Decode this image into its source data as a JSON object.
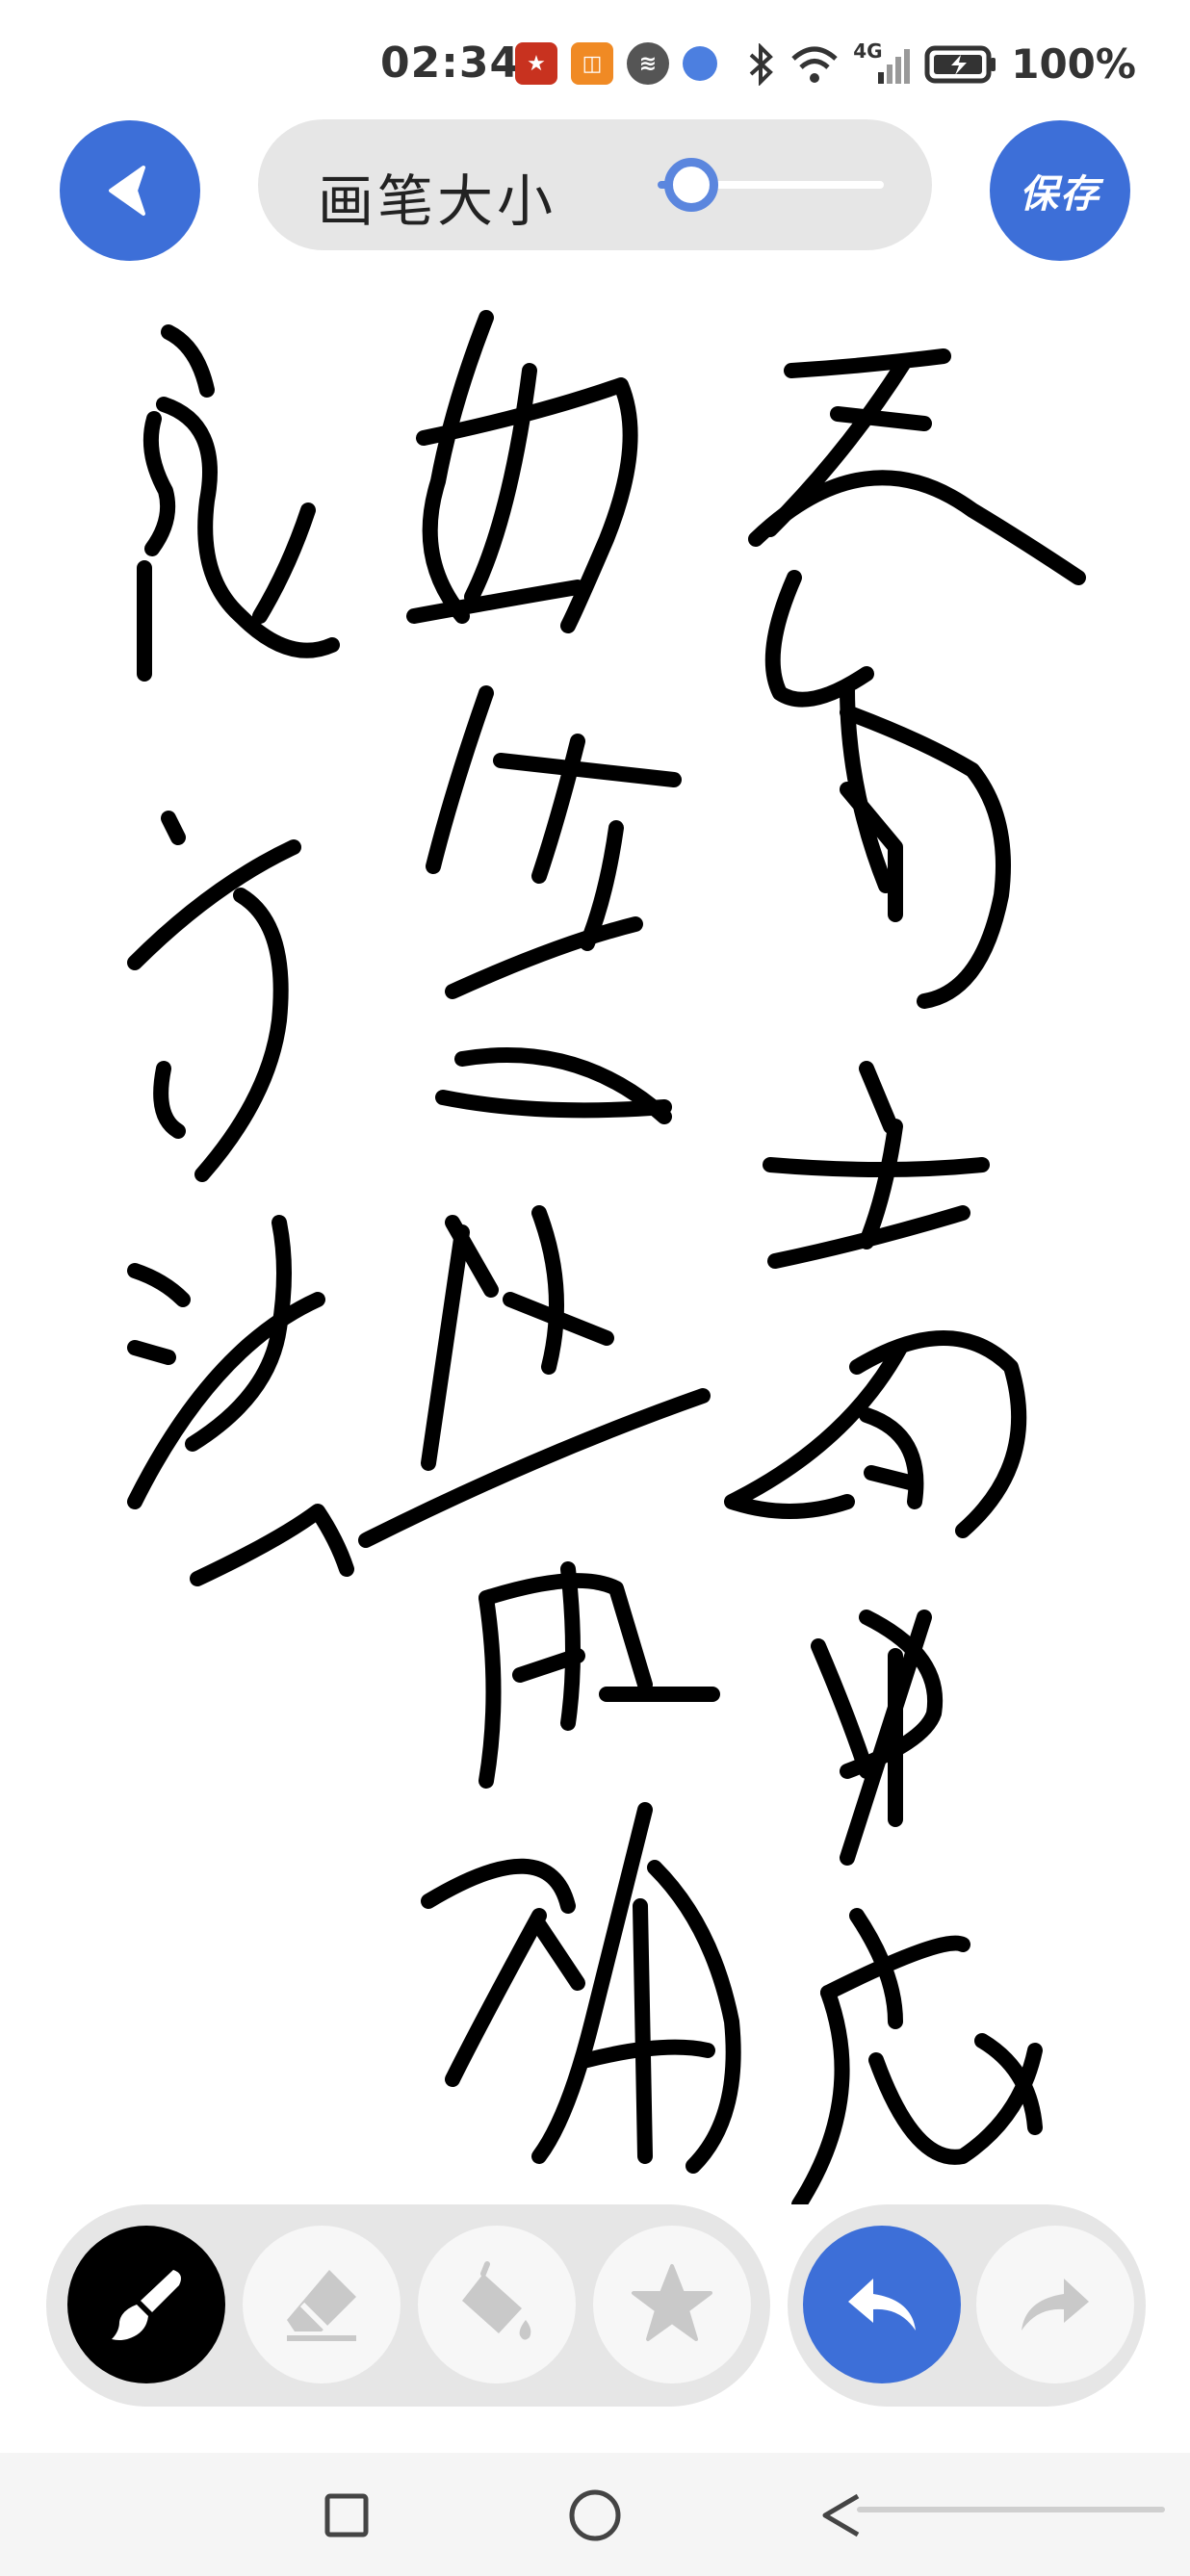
{
  "status_bar": {
    "time": "02:34",
    "battery": "100%",
    "network": "4G",
    "app_icons": [
      "app-red-icon",
      "app-orange-icon",
      "voice-app-icon",
      "browser-app-icon"
    ]
  },
  "toolbar": {
    "brush_size_label": "画笔大小",
    "brush_size_level": 0.15,
    "save_label": "保存"
  },
  "tools": {
    "items": [
      "brush-icon",
      "eraser-icon",
      "fill-bucket-icon",
      "star-stamp-icon"
    ],
    "active": "brush-icon",
    "undo": "undo-icon",
    "redo": "redo-icon"
  },
  "colors": {
    "accent": "#3d6fd8",
    "panel": "#e6e6e6",
    "ink": "#000000",
    "inactive_icon": "#c9c9c9"
  }
}
